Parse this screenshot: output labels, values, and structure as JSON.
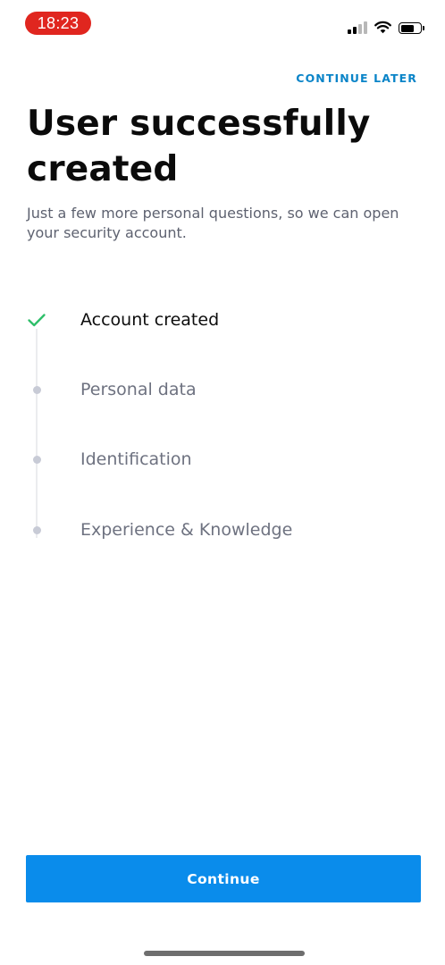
{
  "status_bar": {
    "time": "18:23",
    "icons": [
      "signal-icon",
      "wifi-icon",
      "battery-icon"
    ],
    "time_pill_color": "#e0261f"
  },
  "header": {
    "continue_later_label": "CONTINUE LATER"
  },
  "main": {
    "title": "User successfully created",
    "subtitle": "Just a few more personal questions, so we can open your security account."
  },
  "steps": [
    {
      "label": "Account created",
      "status": "completed",
      "icon": "checkmark-icon"
    },
    {
      "label": "Personal data",
      "status": "pending",
      "icon": "dot-icon"
    },
    {
      "label": "Identification",
      "status": "pending",
      "icon": "dot-icon"
    },
    {
      "label": "Experience & Knowledge",
      "status": "pending",
      "icon": "dot-icon"
    }
  ],
  "footer": {
    "continue_label": "Continue"
  },
  "colors": {
    "accent": "#0a8ceb",
    "link": "#0a84c8",
    "success": "#2fbf6a",
    "pending_dot": "#c8cbd6"
  }
}
